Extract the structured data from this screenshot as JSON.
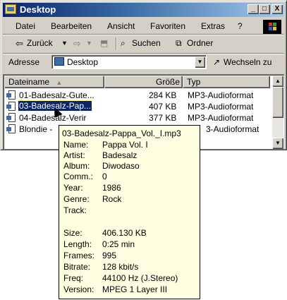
{
  "window": {
    "title": "Desktop",
    "minimize": "_",
    "maximize": "□",
    "close": "X"
  },
  "menu": {
    "items": [
      "Datei",
      "Bearbeiten",
      "Ansicht",
      "Favoriten",
      "Extras",
      "?"
    ]
  },
  "toolbar": {
    "back": "Zurück",
    "search": "Suchen",
    "folders": "Ordner"
  },
  "address": {
    "label": "Adresse",
    "value": "Desktop",
    "go": "Wechseln zu"
  },
  "list": {
    "columns": [
      "Dateiname",
      "Größe",
      "Typ"
    ],
    "rows": [
      {
        "name": "01-Badesalz-Gute...",
        "size": "284 KB",
        "type": "MP3-Audioformat"
      },
      {
        "name": "03-Badesalz-Pap...",
        "size": "407 KB",
        "type": "MP3-Audioformat",
        "selected": true
      },
      {
        "name": "04-Badesalz-Verir",
        "size": "377 KB",
        "type": "MP3-Audioformat"
      },
      {
        "name": "Blondie -",
        "size": "",
        "type": "3-Audioformat"
      }
    ]
  },
  "tooltip": {
    "title": "03-Badesalz-Pappa_Vol._I.mp3",
    "fields": [
      {
        "k": "Name:",
        "v": "Pappa Vol. I"
      },
      {
        "k": "Artist:",
        "v": "Badesalz"
      },
      {
        "k": "Album:",
        "v": "Diwodaso"
      },
      {
        "k": "Comm.:",
        "v": "0"
      },
      {
        "k": "Year:",
        "v": "1986"
      },
      {
        "k": "Genre:",
        "v": "Rock"
      },
      {
        "k": "Track:",
        "v": ""
      },
      {
        "k": "Size:",
        "v": "406.130 KB"
      },
      {
        "k": "Length:",
        "v": "0:25 min"
      },
      {
        "k": "Frames:",
        "v": "995"
      },
      {
        "k": "Bitrate:",
        "v": "128 kbit/s"
      },
      {
        "k": "Freq:",
        "v": "44100 Hz (J.Stereo)"
      },
      {
        "k": "Version:",
        "v": "MPEG 1 Layer III"
      }
    ]
  },
  "colors": {
    "title_start": "#0a246a",
    "title_end": "#a6caf0",
    "selection": "#0a246a",
    "tooltip_bg": "#ffffe1"
  }
}
